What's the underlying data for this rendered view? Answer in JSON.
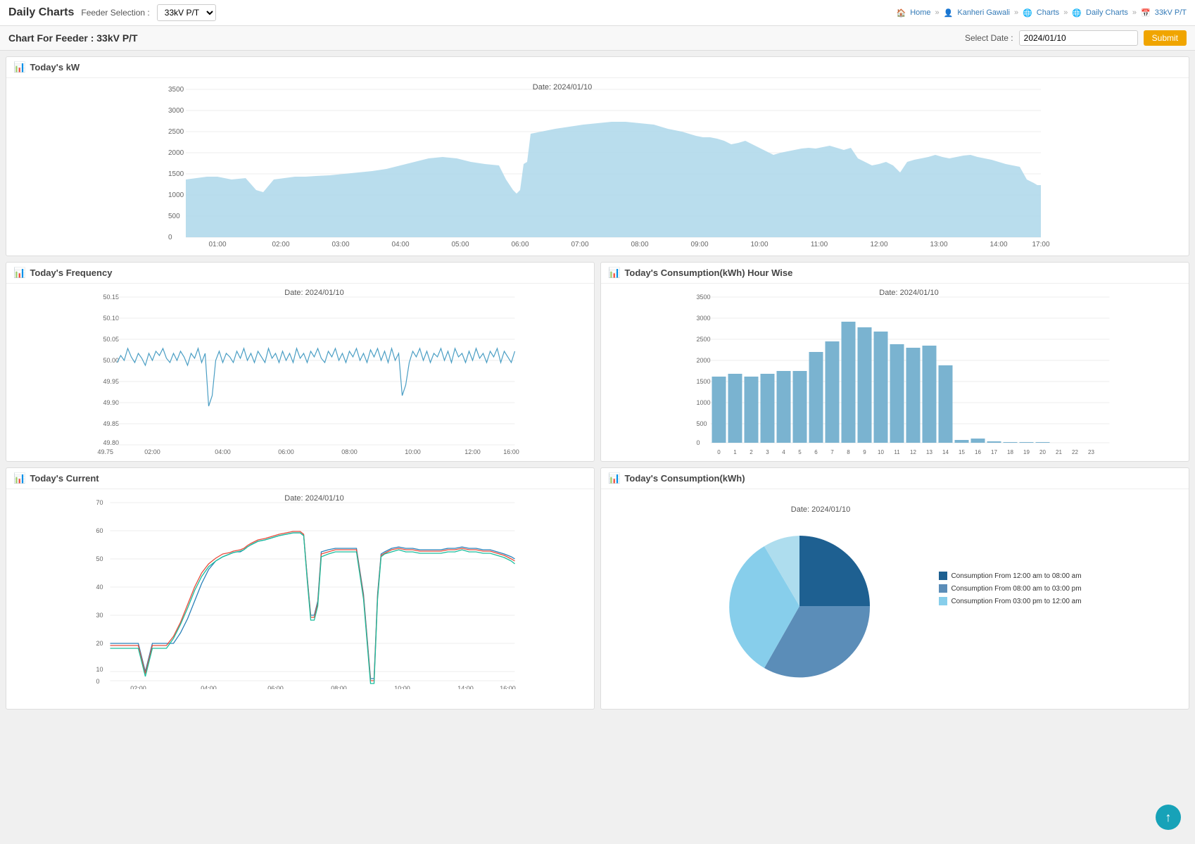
{
  "header": {
    "title": "Daily Charts",
    "feeder_label": "Feeder Selection :",
    "feeder_value": "33kV P/T",
    "feeder_options": [
      "33kV P/T"
    ]
  },
  "nav": {
    "home": "Home",
    "kanheri_gawali": "Kanheri Gawali",
    "charts": "Charts",
    "daily_charts": "Daily Charts",
    "feeder": "33kV P/T"
  },
  "sub_header": {
    "chart_for_feeder": "Chart For Feeder :  33kV P/T",
    "select_date_label": "Select Date :",
    "date_value": "2024/01/10",
    "submit_label": "Submit"
  },
  "charts": {
    "kw": {
      "title": "Today's kW",
      "date_label": "Date: 2024/01/10"
    },
    "frequency": {
      "title": "Today's Frequency",
      "date_label": "Date: 2024/01/10"
    },
    "consumption_hourwise": {
      "title": "Today's Consumption(kWh) Hour Wise",
      "date_label": "Date: 2024/01/10"
    },
    "current": {
      "title": "Today's Current",
      "date_label": "Date: 2024/01/10"
    },
    "consumption_kwh": {
      "title": "Today's Consumption(kWh)",
      "date_label": "Date: 2024/01/10",
      "legend": [
        {
          "label": "Consumption From 12:00 am to 08:00 am",
          "color": "#1e6091"
        },
        {
          "label": "Consumption From 08:00 am to 03:00 pm",
          "color": "#5b8db8"
        },
        {
          "label": "Consumption From 03:00 pm to 12:00 am",
          "color": "#a8d5e8"
        }
      ]
    }
  }
}
